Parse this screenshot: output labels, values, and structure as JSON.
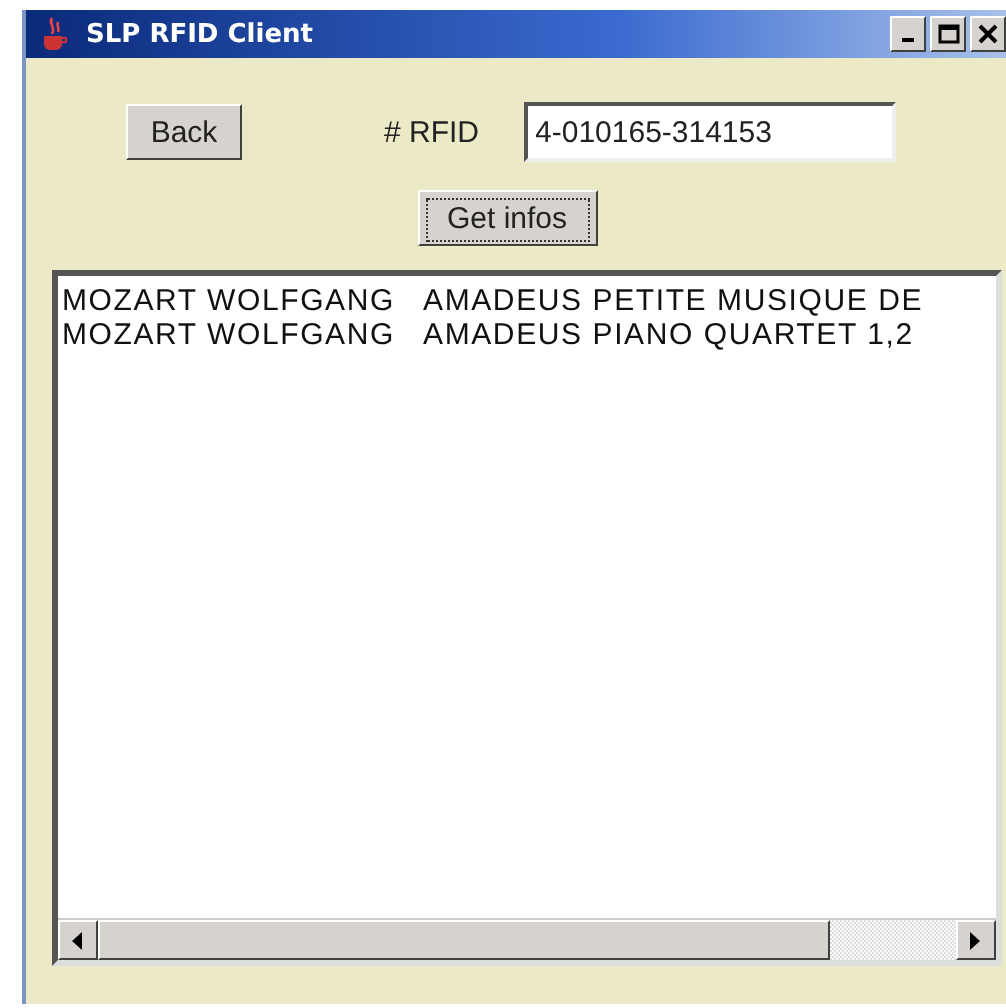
{
  "window": {
    "title": "SLP RFID Client"
  },
  "back_button": "Back",
  "rfid": {
    "label": "# RFID",
    "value": "4-010165-314153"
  },
  "get_button": "Get infos",
  "results": [
    {
      "text": "MOZART WOLFGANG   AMADEUS PETITE MUSIQUE DE"
    },
    {
      "text": "MOZART WOLFGANG   AMADEUS PIANO QUARTET 1,2"
    }
  ]
}
